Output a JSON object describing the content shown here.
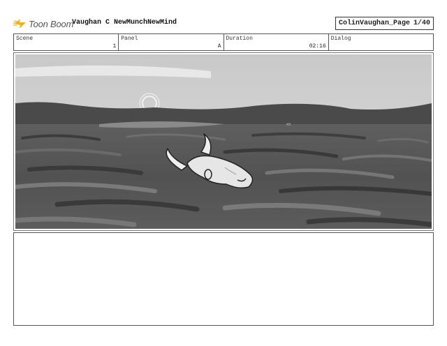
{
  "header": {
    "logo_text": "Toon Boom",
    "project_title": "Vaughan C NewMunchNewMind",
    "page_name": "ColinVaughan_Page",
    "page_number": "1/40"
  },
  "meta": {
    "scene_label": "Scene",
    "scene_value": "1",
    "panel_label": "Panel",
    "panel_value": "A",
    "duration_label": "Duration",
    "duration_value": "02:16",
    "dialog_label": "Dialog",
    "dialog_value": ""
  },
  "panel": {
    "image_icon": "storyboard-sketch",
    "colors": {
      "sky": "#d6d6d6",
      "water_dark": "#555555",
      "skull": "#e6e6e6"
    }
  },
  "notes": {
    "text": ""
  }
}
